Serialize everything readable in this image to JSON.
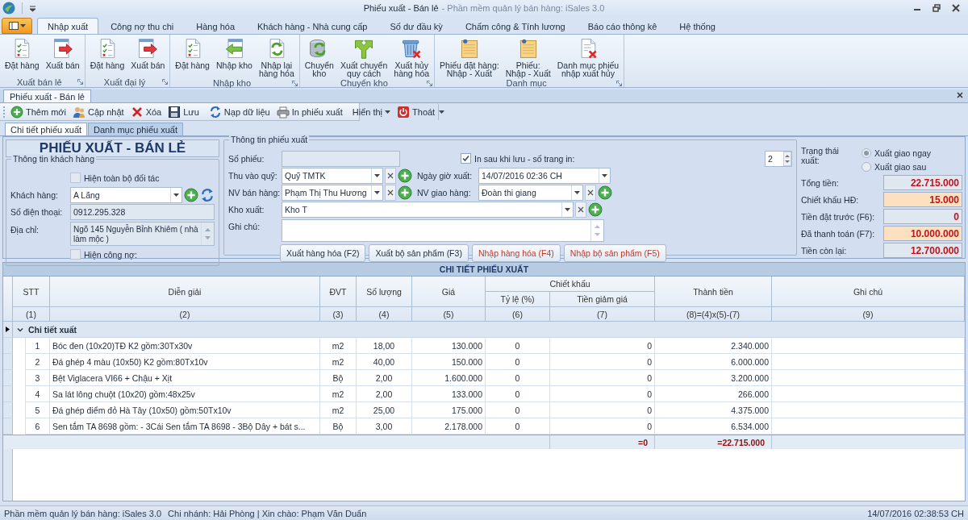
{
  "window": {
    "title": "Phiếu xuất - Bán lẻ",
    "app_name": "- Phần mềm quản lý bán hàng: iSales 3.0"
  },
  "ribbon": {
    "tabs": [
      {
        "label": "Nhập xuất",
        "selected": true
      },
      {
        "label": "Công nợ thu chi",
        "selected": false
      },
      {
        "label": "Hàng hóa",
        "selected": false
      },
      {
        "label": "Khách hàng - Nhà cung cấp",
        "selected": false
      },
      {
        "label": "Số dư đầu kỳ",
        "selected": false
      },
      {
        "label": "Chấm công & Tính lương",
        "selected": false
      },
      {
        "label": "Báo cáo thông kê",
        "selected": false
      },
      {
        "label": "Hệ thống",
        "selected": false
      }
    ],
    "groups": [
      {
        "label": "Xuất bán lẻ",
        "buttons": [
          {
            "label": "Đặt hàng",
            "kind": "order"
          },
          {
            "label": "Xuất bán",
            "kind": "export"
          }
        ]
      },
      {
        "label": "Xuất đại lý",
        "buttons": [
          {
            "label": "Đặt hàng",
            "kind": "order"
          },
          {
            "label": "Xuất bán",
            "kind": "export"
          }
        ]
      },
      {
        "label": "Nhập kho",
        "buttons": [
          {
            "label": "Đặt hàng",
            "kind": "order"
          },
          {
            "label": "Nhập kho",
            "kind": "import"
          },
          {
            "label": "Nhập lại\nhàng hóa",
            "kind": "reimport"
          }
        ]
      },
      {
        "label": "Chuyển kho",
        "buttons": [
          {
            "label": "Chuyển\nkho",
            "kind": "transfer"
          },
          {
            "label": "Xuất chuyển\nquy cách",
            "kind": "convert"
          },
          {
            "label": "Xuất hủy\nhàng hóa",
            "kind": "dispose"
          }
        ]
      },
      {
        "label": "Danh mục",
        "buttons": [
          {
            "label": "Phiếu đặt hàng:\nNhập - Xuất",
            "kind": "voucher"
          },
          {
            "label": "Phiếu:\nNhập - Xuất",
            "kind": "voucher"
          },
          {
            "label": "Danh mục phiếu\nnhập xuất hủy",
            "kind": "cancel-list"
          }
        ]
      }
    ]
  },
  "document_tabs": [
    {
      "label": "Phiếu xuất - Bán lẻ",
      "selected": true
    }
  ],
  "toolbar": {
    "groups": [
      [
        {
          "label": "Thêm mới",
          "kind": "add"
        },
        {
          "label": "Cập nhật",
          "kind": "update"
        },
        {
          "label": "Xóa",
          "kind": "delete"
        },
        {
          "label": "Lưu",
          "kind": "save"
        }
      ],
      [
        {
          "label": "Nạp dữ liệu",
          "kind": "reload"
        },
        {
          "label": "In phiếu xuất",
          "kind": "print"
        }
      ],
      [
        {
          "label": "Hiển thị",
          "kind": "view"
        },
        {
          "label": "Thoát",
          "kind": "exit"
        }
      ]
    ]
  },
  "sub_tabs": [
    {
      "label": "Chi tiết phiếu xuất",
      "selected": true
    },
    {
      "label": "Danh mục phiếu xuất",
      "selected": false
    }
  ],
  "form": {
    "title": "PHIẾU XUẤT - BÁN LẺ",
    "customer": {
      "legend": "Thông tin khách hàng",
      "show_all": {
        "label": "Hiện toàn bộ đối tác",
        "checked": false,
        "disabled": true
      },
      "customer": {
        "label": "Khách hàng:",
        "value": "A Lãng"
      },
      "phone": {
        "label": "Số điện thoại:",
        "value": "0912.295.328"
      },
      "address": {
        "label": "Địa chỉ:",
        "value": "Ngõ 145 Nguyễn Bỉnh Khiêm ( nhà làm mộc )"
      },
      "show_debt": {
        "label": "Hiện công nợ:",
        "checked": false,
        "disabled": true
      }
    },
    "invoice": {
      "legend": "Thông tin phiếu xuất",
      "number": {
        "label": "Số phiếu:"
      },
      "print_after_save": {
        "label": "In sau khi lưu - số trang in:",
        "checked": true,
        "disabled": false
      },
      "copies": {
        "value": "2"
      },
      "fund": {
        "label": "Thu vào quỹ:",
        "value": "Quỹ TMTK"
      },
      "date": {
        "label": "Ngày giờ xuất:",
        "value": "14/07/2016 02:36 CH"
      },
      "salesperson": {
        "label": "NV bán hàng:",
        "value": "Phạm Thị Thu Hương"
      },
      "shipper": {
        "label": "NV giao hàng:",
        "value": "Đoàn thi giang"
      },
      "warehouse": {
        "label": "Kho xuất:",
        "value": "Kho T"
      },
      "note": {
        "label": "Ghi chú:"
      },
      "buttons": [
        {
          "label": "Xuất hàng hóa (F2)",
          "kind": "export"
        },
        {
          "label": "Xuất bộ sản phẩm (F3)",
          "kind": "export"
        },
        {
          "label": "Nhập hàng hóa (F4)",
          "kind": "import"
        },
        {
          "label": "Nhập bộ sản phẩm (F5)",
          "kind": "import"
        }
      ]
    },
    "summary": {
      "status_label": "Trạng thái xuất:",
      "options": [
        {
          "label": "Xuất giao ngay",
          "selected": true
        },
        {
          "label": "Xuất giao sau",
          "selected": false
        }
      ],
      "totals": [
        {
          "label": "Tổng tiền:",
          "value": "22.715.000",
          "editable": false
        },
        {
          "label": "Chiết khấu HĐ:",
          "value": "15.000",
          "editable": true
        },
        {
          "label": "Tiền đặt trước (F6):",
          "value": "0",
          "editable": false
        },
        {
          "label": "Đã thanh toán (F7):",
          "value": "10.000.000",
          "editable": true
        },
        {
          "label": "Tiền còn lại:",
          "value": "12.700.000",
          "editable": false
        }
      ]
    }
  },
  "grid": {
    "title": "CHI TIẾT PHIẾU XUẤT",
    "columns": [
      {
        "label": "STT",
        "index": "(1)"
      },
      {
        "label": "Diễn giải",
        "index": "(2)"
      },
      {
        "label": "ĐVT",
        "index": "(3)"
      },
      {
        "label": "Số lượng",
        "index": "(4)"
      },
      {
        "label": "Giá",
        "index": "(5)"
      },
      {
        "kind": "band",
        "label": "Chiết khấu",
        "columns": [
          {
            "label": "Tỷ lệ (%)",
            "index": "(6)"
          },
          {
            "label": "Tiền giảm giá",
            "index": "(7)"
          }
        ]
      },
      {
        "label": "Thành tiền",
        "index": "(8)=(4)x(5)-(7)"
      },
      {
        "label": "Ghi chú",
        "index": "(9)"
      }
    ],
    "group": {
      "label": "Chi tiết xuất",
      "expanded": true,
      "focused": true,
      "rows": [
        {
          "stt": "1",
          "description": "Bóc đen (10x20)TĐ K2 gồm:30Tx30v",
          "unit": "m2",
          "quantity": "18,00",
          "price": "130.000",
          "rate": "0",
          "discount": "0",
          "amount": "2.340.000"
        },
        {
          "stt": "2",
          "description": "Đá ghép 4 màu (10x50) K2 gồm:80Tx10v",
          "unit": "m2",
          "quantity": "40,00",
          "price": "150.000",
          "rate": "0",
          "discount": "0",
          "amount": "6.000.000"
        },
        {
          "stt": "3",
          "description": "Bệt Viglacera VI66 + Chậu + Xịt",
          "unit": "Bộ",
          "quantity": "2,00",
          "price": "1.600.000",
          "rate": "0",
          "discount": "0",
          "amount": "3.200.000"
        },
        {
          "stt": "4",
          "description": "Sa lát lông chuột (10x20) gồm:48x25v",
          "unit": "m2",
          "quantity": "2,00",
          "price": "133.000",
          "rate": "0",
          "discount": "0",
          "amount": "266.000"
        },
        {
          "stt": "5",
          "description": "Đá ghép điểm đỏ Hà Tây (10x50) gồm:50Tx10v",
          "unit": "m2",
          "quantity": "25,00",
          "price": "175.000",
          "rate": "0",
          "discount": "0",
          "amount": "4.375.000"
        },
        {
          "stt": "6",
          "description": "Sen tắm TA 8698 gồm: - 3Cái Sen tắm TA 8698 - 3Bộ Dây + bát s...",
          "unit": "Bộ",
          "quantity": "3,00",
          "price": "2.178.000",
          "rate": "0",
          "discount": "0",
          "amount": "6.534.000"
        }
      ]
    },
    "totals": {
      "discount": "=0",
      "amount": "=22.715.000"
    }
  },
  "status_bar": {
    "app": "Phần mềm quản lý bán hàng: iSales 3.0",
    "session": "Chi nhánh: Hải Phòng | Xin chào: Phạm Văn Duẩn",
    "clock": "14/07/2016 02:38:53 CH"
  }
}
